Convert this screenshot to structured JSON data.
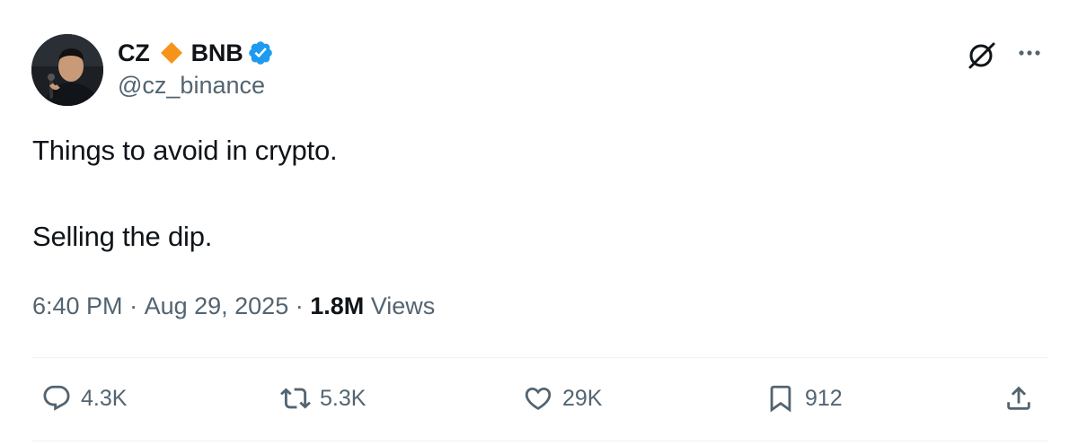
{
  "author": {
    "name_part1": "CZ",
    "name_part2": "BNB",
    "handle": "@cz_binance",
    "avatar": "portrait-with-microphone",
    "diamond_color": "#f7931a",
    "verified_color": "#1d9bf0"
  },
  "header_icons": {
    "grok": "grok-icon",
    "more": "more-icon"
  },
  "tweet": {
    "line1": "Things to avoid in crypto.",
    "line2": "Selling the dip."
  },
  "meta": {
    "time": "6:40 PM",
    "separator": " · ",
    "date": "Aug 29, 2025",
    "views_count": "1.8M",
    "views_label": " Views"
  },
  "actions": {
    "replies": "4.3K",
    "reposts": "5.3K",
    "likes": "29K",
    "bookmarks": "912"
  },
  "colors": {
    "text": "#0f1419",
    "secondary": "#536471",
    "divider": "#eff3f4"
  }
}
